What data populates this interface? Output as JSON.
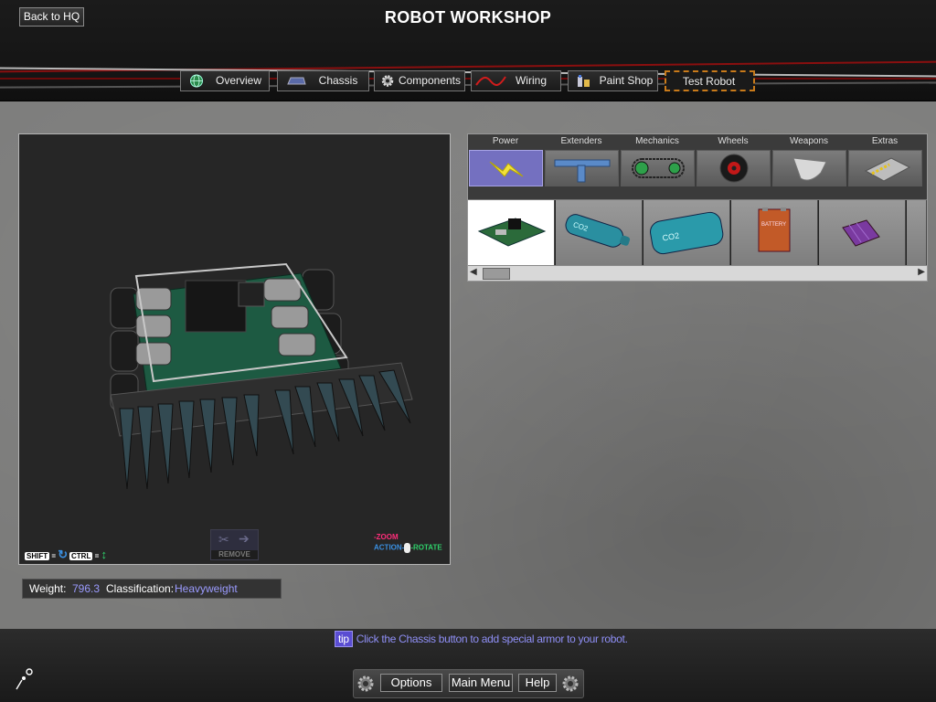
{
  "header": {
    "back_label": "Back to HQ",
    "title": "ROBOT WORKSHOP"
  },
  "tabs": [
    {
      "label": "Overview",
      "icon": "globe-icon"
    },
    {
      "label": "Chassis",
      "icon": "chassis-icon"
    },
    {
      "label": "Components",
      "icon": "gear-icon"
    },
    {
      "label": "Wiring",
      "icon": "wire-icon"
    },
    {
      "label": "Paint Shop",
      "icon": "paint-icon"
    },
    {
      "label": "Test Robot",
      "icon": ""
    }
  ],
  "viewport": {
    "shift_key": "SHIFT",
    "ctrl_key": "CTRL",
    "equals": "=",
    "remove_label": "REMOVE",
    "zoom_label": "ZOOM",
    "action_label": "ACTION",
    "rotate_label": "ROTATE"
  },
  "stats": {
    "weight_label": "Weight:",
    "weight_value": "796.3",
    "class_label": "Classification:",
    "class_value": "Heavyweight"
  },
  "categories": [
    {
      "label": "Power",
      "icon": "lightning-icon",
      "active": true
    },
    {
      "label": "Extenders",
      "icon": "extender-icon"
    },
    {
      "label": "Mechanics",
      "icon": "chain-drive-icon"
    },
    {
      "label": "Wheels",
      "icon": "wheel-icon"
    },
    {
      "label": "Weapons",
      "icon": "blade-icon"
    },
    {
      "label": "Extras",
      "icon": "armor-plate-icon"
    }
  ],
  "parts": [
    {
      "name": "circuit-board",
      "label": "",
      "selected": true
    },
    {
      "name": "co2-canister",
      "label": "CO2"
    },
    {
      "name": "co2-tank",
      "label": "CO2"
    },
    {
      "name": "battery-box",
      "label": "BATTERY"
    },
    {
      "name": "battery-pack",
      "label": ""
    }
  ],
  "tip": {
    "badge": "tip",
    "text": "Click the Chassis button to add special armor to your robot."
  },
  "menu": {
    "options": "Options",
    "main_menu": "Main Menu",
    "help": "Help"
  },
  "colors": {
    "accent_purple": "#7470c0",
    "tip_text": "#8f8ff6",
    "stat_value": "#9b9bff",
    "test_border": "#c87a1a"
  }
}
